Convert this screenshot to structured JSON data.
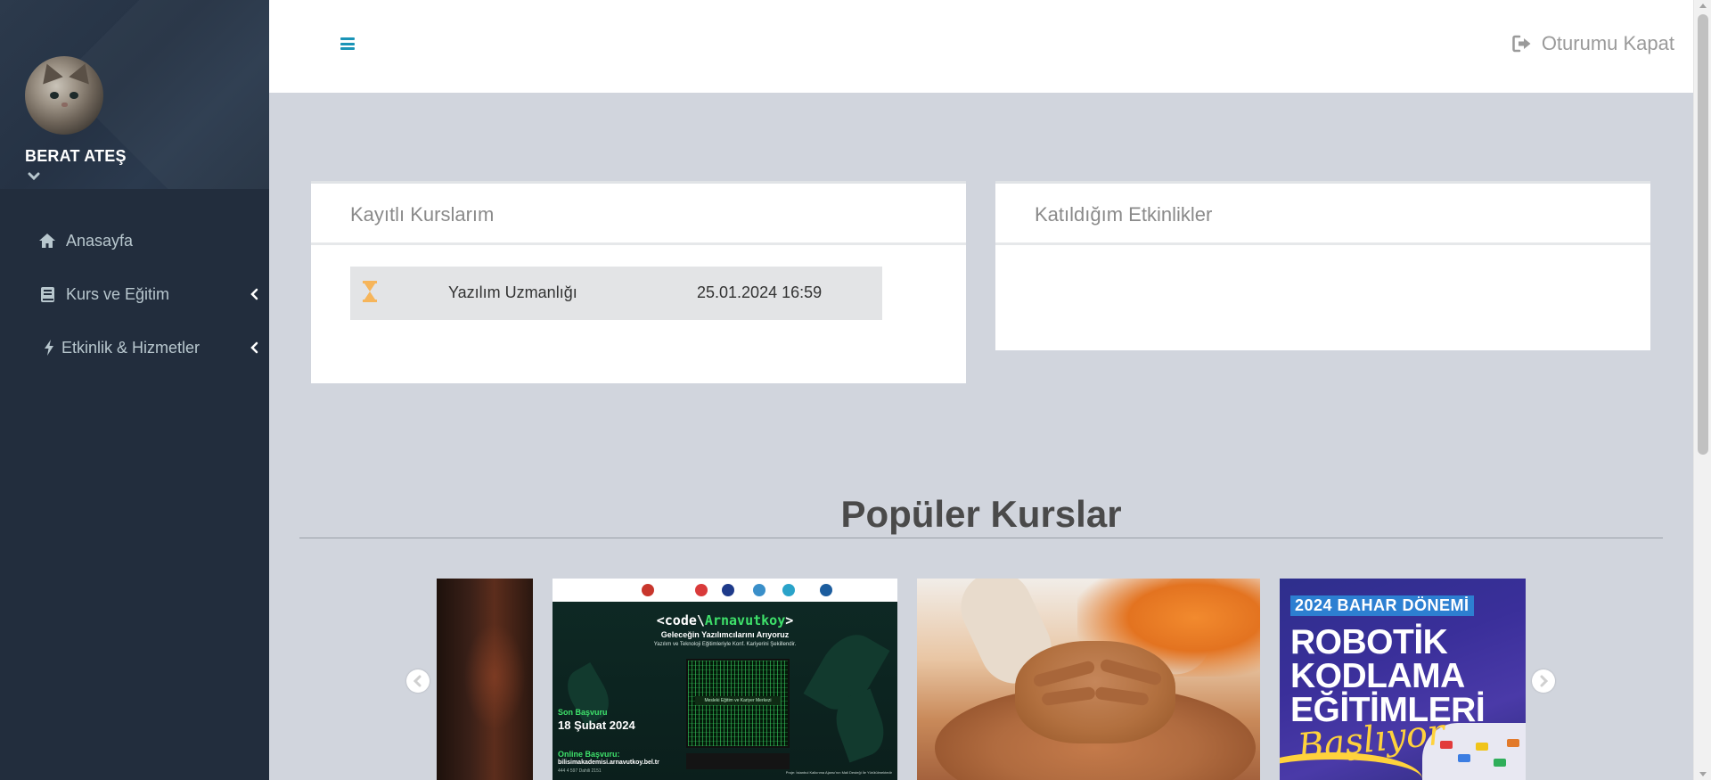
{
  "user": {
    "name": "BERAT ATEŞ"
  },
  "sidebar": {
    "items": [
      {
        "label": "Anasayfa"
      },
      {
        "label": "Kurs ve Eğitim"
      },
      {
        "label": "Etkinlik & Hizmetler"
      }
    ]
  },
  "header": {
    "logout_label": "Oturumu Kapat"
  },
  "registered_courses": {
    "title": "Kayıtlı Kurslarım",
    "rows": [
      {
        "name": "Yazılım Uzmanlığı",
        "date": "25.01.2024 16:59"
      }
    ]
  },
  "events": {
    "title": "Katıldığım Etkinlikler"
  },
  "popular": {
    "title": "Popüler Kurslar",
    "slides": {
      "code": {
        "headline_prefix": "<code\\",
        "headline_brand": "Arnavutkoy",
        "headline_suffix": ">",
        "subheadline": "Geleceğin Yazılımcılarını Arıyoruz",
        "tagline": "Yazılım ve Teknoloji Eğitimleriyle Konf. Kariyerini Şekillendir.",
        "screen_badge": "Mesleki Eğitim ve Kariyer Merkezi",
        "deadline_label": "Son Başvuru",
        "deadline_date": "18 Şubat 2024",
        "online_label": "Online Başvuru:",
        "online_url": "bilisimakademisi.arnavutkoy.bel.tr",
        "phone": "444 4 597 Dahili 2151",
        "footer_note": "Proje: İstanbul Kalkınma Ajansı'nın Mali Desteği İle Yürütülmektedir"
      },
      "robotik": {
        "header": "2024 BAHAR DÖNEMİ",
        "line1": "ROBOTİK",
        "line2": "KODLAMA",
        "line3": "EĞİTİMLERİ",
        "script": "Başlıyor"
      }
    }
  },
  "colors": {
    "sidebar_bg": "#222d3d",
    "accent": "#1a94b7",
    "content_bg": "#d1d5dd",
    "hourglass": "#f6b55b"
  }
}
